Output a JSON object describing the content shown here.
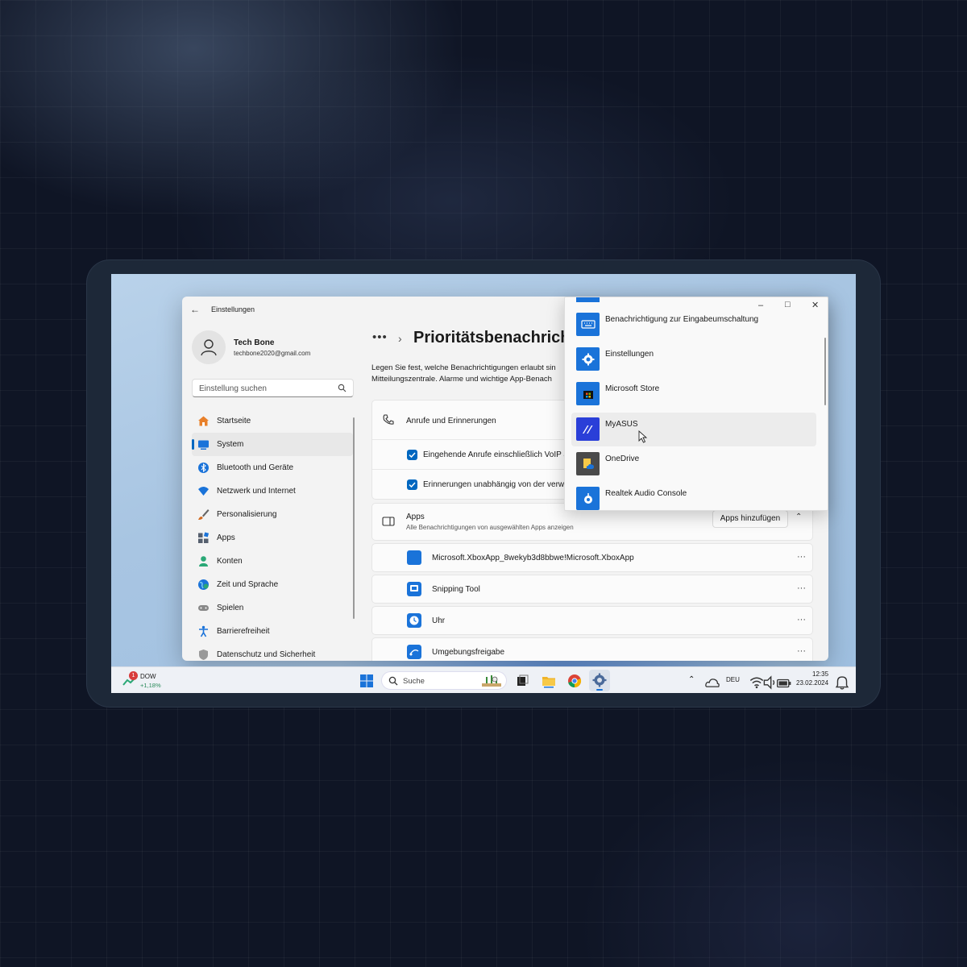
{
  "window": {
    "title": "Einstellungen"
  },
  "profile": {
    "name": "Tech Bone",
    "email": "techbone2020@gmail.com"
  },
  "search": {
    "placeholder": "Einstellung suchen"
  },
  "nav": [
    {
      "label": "Startseite",
      "icon": "home-icon",
      "color": "#e8802a"
    },
    {
      "label": "System",
      "icon": "system-icon",
      "color": "#1a73d9",
      "active": true
    },
    {
      "label": "Bluetooth und Geräte",
      "icon": "bluetooth-icon",
      "color": "#1a73d9"
    },
    {
      "label": "Netzwerk und Internet",
      "icon": "network-icon",
      "color": "#1a73d9"
    },
    {
      "label": "Personalisierung",
      "icon": "brush-icon",
      "color": "#d2691e"
    },
    {
      "label": "Apps",
      "icon": "apps-icon",
      "color": "#555f6e"
    },
    {
      "label": "Konten",
      "icon": "person-icon",
      "color": "#2aa876"
    },
    {
      "label": "Zeit und Sprache",
      "icon": "globe-icon",
      "color": "#1a73d9"
    },
    {
      "label": "Spielen",
      "icon": "gamepad-icon",
      "color": "#777"
    },
    {
      "label": "Barrierefreiheit",
      "icon": "accessibility-icon",
      "color": "#1a73d9"
    },
    {
      "label": "Datenschutz und Sicherheit",
      "icon": "shield-icon",
      "color": "#888"
    }
  ],
  "page": {
    "title": "Prioritätsbenachrich",
    "description_line1": "Legen Sie fest, welche Benachrichtigungen erlaubt sin",
    "description_line2": "Mitteilungszentrale. Alarme und wichtige App-Benach"
  },
  "calls": {
    "title": "Anrufe und Erinnerungen",
    "check1": "Eingehende Anrufe einschließlich VoIP a",
    "check2": "Erinnerungen unabhängig von der verw"
  },
  "apps_section": {
    "title": "Apps",
    "subtitle": "Alle Benachrichtigungen von ausgewählten Apps anzeigen",
    "add_button": "Apps hinzufügen",
    "more_glyph": "···",
    "items": [
      {
        "label": "Microsoft.XboxApp_8wekyb3d8bbwe!Microsoft.XboxApp",
        "icon": "xbox-app-icon",
        "color": "#1a73d9"
      },
      {
        "label": "Snipping Tool",
        "icon": "snipping-tool-icon",
        "color": "#1a73d9"
      },
      {
        "label": "Uhr",
        "icon": "clock-icon",
        "color": "#1a73d9"
      },
      {
        "label": "Umgebungsfreigabe",
        "icon": "nearby-share-icon",
        "color": "#1a73d9"
      }
    ]
  },
  "popup": {
    "items": [
      {
        "label": "Benachrichtigung zur Eingabeumschaltung",
        "icon": "keyboard-icon",
        "color": "#1a73d9"
      },
      {
        "label": "Einstellungen",
        "icon": "gear-icon",
        "color": "#1a73d9"
      },
      {
        "label": "Microsoft Store",
        "icon": "store-icon",
        "color": "#1a73d9"
      },
      {
        "label": "MyASUS",
        "icon": "myasus-icon",
        "color": "#2a3fd8"
      },
      {
        "label": "OneDrive",
        "icon": "onedrive-icon",
        "color": "#4a4a4a"
      },
      {
        "label": "Realtek Audio Console",
        "icon": "realtek-icon",
        "color": "#1a73d9"
      }
    ]
  },
  "taskbar": {
    "stock_name": "DOW",
    "stock_change": "+1,18%",
    "stock_badge": "1",
    "search_label": "Suche",
    "language": "DEU",
    "time": "12:35",
    "date": "23.02.2024"
  }
}
